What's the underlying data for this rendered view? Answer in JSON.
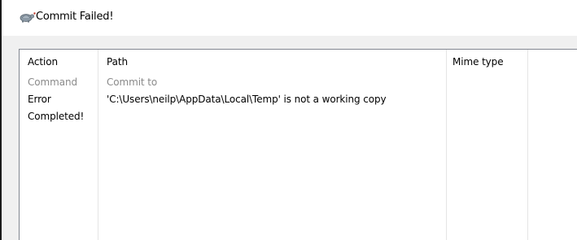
{
  "window": {
    "title": "Commit Failed!",
    "icon": "tortoise-icon"
  },
  "list": {
    "columns": [
      "Action",
      "Path",
      "Mime type"
    ],
    "rows": [
      {
        "action": "Command",
        "path": "Commit to",
        "style": "dim"
      },
      {
        "action": "Error",
        "path": "'C:\\Users\\neilp\\AppData\\Local\\Temp' is not a working copy",
        "style": "normal"
      },
      {
        "action": "Completed!",
        "path": "",
        "style": "normal"
      }
    ]
  }
}
